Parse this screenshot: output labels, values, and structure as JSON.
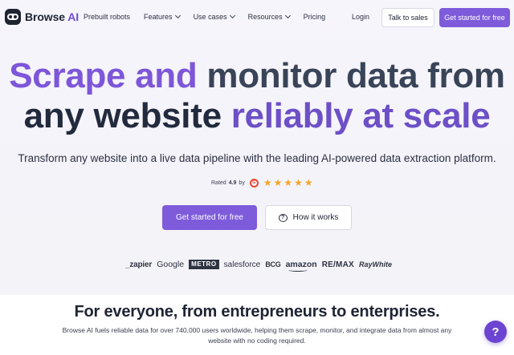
{
  "brand": {
    "name": "Browse",
    "name_suffix": "AI"
  },
  "nav": {
    "links": [
      {
        "label": "Prebuilt robots",
        "has_dropdown": false
      },
      {
        "label": "Features",
        "has_dropdown": true
      },
      {
        "label": "Use cases",
        "has_dropdown": true
      },
      {
        "label": "Resources",
        "has_dropdown": true
      },
      {
        "label": "Pricing",
        "has_dropdown": false
      }
    ],
    "login_label": "Login",
    "talk_label": "Talk to sales",
    "cta_label": "Get started for free"
  },
  "hero": {
    "line1_a": "Scrape and",
    "line1_b": "monitor data from",
    "line2_a": "any website",
    "line2_b": "reliably at scale",
    "subtitle": "Transform any website into a live data pipeline with the leading AI-powered data extraction platform.",
    "rating_prefix": "Rated",
    "rating_value": "4.9",
    "rating_suffix": "by",
    "rating_source_icon": "g2-icon",
    "stars": 5,
    "primary_cta": "Get started for free",
    "secondary_cta": "How it works"
  },
  "logos": [
    "_zapier",
    "Google",
    "METRO",
    "salesforce",
    "BCG",
    "amazon",
    "RE/MAX",
    "RayWhite"
  ],
  "section": {
    "title": "For everyone, from entrepreneurs to enterprises.",
    "body": "Browse AI fuels reliable data for over 740,000 users worldwide, helping them scrape, monitor, and integrate data from almost any website with no coding required."
  },
  "help": {
    "icon": "question-mark-icon",
    "label": "?"
  },
  "colors": {
    "accent": "#7e5bdb",
    "headline_purple": "#7d56d9",
    "headline_dark": "#3a4458",
    "star": "#f5a623",
    "g2": "#ef4a2f"
  }
}
